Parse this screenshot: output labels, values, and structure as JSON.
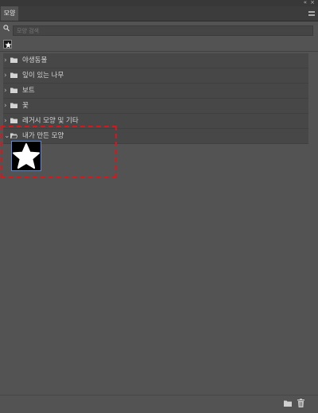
{
  "window": {
    "collapse_glyph": "«",
    "close_glyph": "×"
  },
  "panel": {
    "tab_label": "모양",
    "menu_icon": "panel-menu-icon"
  },
  "search": {
    "placeholder": "모양 검색",
    "icon": "search-icon"
  },
  "recent": {
    "items": [
      {
        "icon": "star-shape-icon"
      }
    ]
  },
  "groups": [
    {
      "label": "야생동물",
      "expanded": false
    },
    {
      "label": "잎이 있는 나무",
      "expanded": false
    },
    {
      "label": "보트",
      "expanded": false
    },
    {
      "label": "꽃",
      "expanded": false
    },
    {
      "label": "레거시 모양 및 기타",
      "expanded": false
    },
    {
      "label": "내가 만든 모양",
      "expanded": true,
      "items": [
        {
          "icon": "star-shape-icon",
          "selected": true
        }
      ]
    }
  ],
  "footer": {
    "new_group_icon": "new-folder-icon",
    "delete_icon": "trash-icon"
  },
  "colors": {
    "panel_bg": "#535353",
    "tab_bar_bg": "#3c3c3c",
    "row_bg": "#474747",
    "selection_border": "#5b8bd8",
    "annotation_red": "#d8161b"
  }
}
